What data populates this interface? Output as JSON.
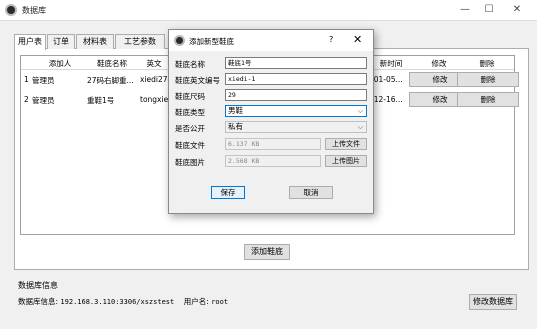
{
  "window": {
    "title": "数据库",
    "minimize": "—",
    "maximize": "☐",
    "close": "✕"
  },
  "tabs": [
    "用户表",
    "订单",
    "材料表",
    "工艺参数"
  ],
  "table": {
    "headers": [
      "添加人",
      "鞋底名称",
      "英文",
      "",
      "",
      "新时间",
      "修改",
      "删除"
    ],
    "rows": [
      {
        "num": "1",
        "added_by": "管理员",
        "name": "27码右脚重...",
        "english": "xiedi27-",
        "time": "-01-05...",
        "edit": "修改",
        "delete": "删除"
      },
      {
        "num": "2",
        "added_by": "管理员",
        "name": "重鞋1号",
        "english": "tongxie",
        "time": "-12-16...",
        "edit": "修改",
        "delete": "删除"
      }
    ]
  },
  "add_button": "添加鞋底",
  "info": {
    "group_title": "数据库信息",
    "label": "数据库信息:",
    "address": "192.168.3.110:3306/xszstest",
    "user_label": "用户名:",
    "user": "root",
    "modify_button": "修改数据库"
  },
  "dialog": {
    "title": "添加新型鞋底",
    "help": "?",
    "close": "✕",
    "fields": {
      "name_label": "鞋底名称",
      "name_value": "鞋底1号",
      "en_label": "鞋底英文编号",
      "en_value": "xiedi-1",
      "size_label": "鞋底尺码",
      "size_value": "29",
      "type_label": "鞋底类型",
      "type_value": "男鞋",
      "public_label": "是否公开",
      "public_value": "私有",
      "file_label": "鞋底文件",
      "file_value": "6.137 KB",
      "file_button": "上传文件",
      "image_label": "鞋底图片",
      "image_value": "2.568 KB",
      "image_button": "上传图片"
    },
    "save": "保存",
    "cancel": "取消"
  }
}
